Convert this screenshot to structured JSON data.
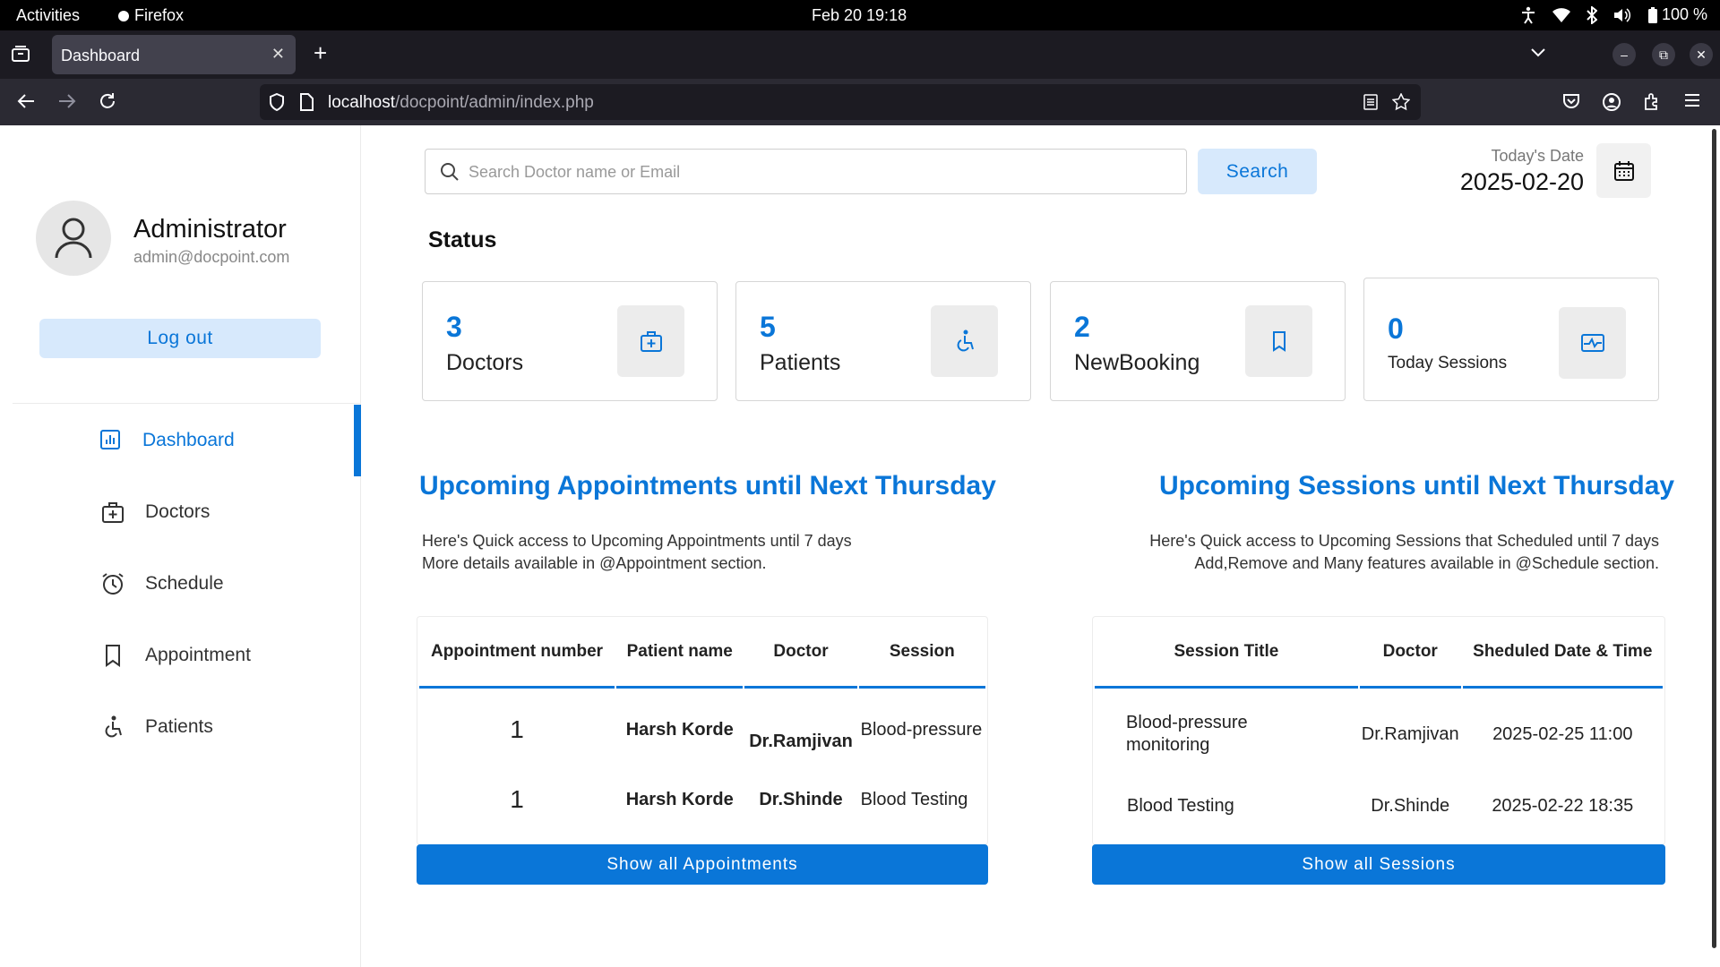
{
  "system_bar": {
    "activities": "Activities",
    "app_name": "Firefox",
    "clock": "Feb 20  19:18",
    "battery": "100 %"
  },
  "browser": {
    "tab_title": "Dashboard",
    "url_host": "localhost",
    "url_path": "/docpoint/admin/index.php"
  },
  "sidebar": {
    "user_name": "Administrator",
    "user_email": "admin@docpoint.com",
    "logout_label": "Log out",
    "items": [
      {
        "label": "Dashboard",
        "icon": "dashboard-icon",
        "active": true
      },
      {
        "label": "Doctors",
        "icon": "doctor-bag-icon",
        "active": false
      },
      {
        "label": "Schedule",
        "icon": "alarm-clock-icon",
        "active": false
      },
      {
        "label": "Appointment",
        "icon": "bookmark-icon",
        "active": false
      },
      {
        "label": "Patients",
        "icon": "wheelchair-icon",
        "active": false
      }
    ]
  },
  "search": {
    "placeholder": "Search Doctor name or Email",
    "button_label": "Search"
  },
  "date": {
    "label": "Today's Date",
    "value": "2025-02-20"
  },
  "status": {
    "title": "Status",
    "cards": [
      {
        "value": "3",
        "label": "Doctors",
        "icon": "doctor-bag-icon"
      },
      {
        "value": "5",
        "label": "Patients",
        "icon": "wheelchair-icon"
      },
      {
        "value": "2",
        "label": "NewBooking",
        "icon": "bookmark-icon"
      },
      {
        "value": "0",
        "label": "Today Sessions",
        "icon": "activity-icon"
      }
    ]
  },
  "appointments": {
    "title": "Upcoming Appointments until Next Thursday",
    "desc_line1": "Here's Quick access to Upcoming Appointments until 7 days",
    "desc_line2": "More details available in @Appointment section.",
    "columns": [
      "Appointment number",
      "Patient name",
      "Doctor",
      "Session"
    ],
    "rows": [
      {
        "number": "1",
        "patient": "Harsh Korde",
        "doctor": "Dr.Ramjivan",
        "session": "Blood-pressure"
      },
      {
        "number": "1",
        "patient": "Harsh Korde",
        "doctor": "Dr.Shinde",
        "session": "Blood Testing"
      }
    ],
    "button_label": "Show all Appointments"
  },
  "sessions": {
    "title": "Upcoming Sessions until Next Thursday",
    "desc_line1": "Here's Quick access to Upcoming Sessions that Scheduled until 7 days",
    "desc_line2": "Add,Remove and Many features available in @Schedule section.",
    "columns": [
      "Session Title",
      "Doctor",
      "Sheduled Date & Time"
    ],
    "rows": [
      {
        "title": "Blood-pressure monitoring",
        "doctor": "Dr.Ramjivan",
        "datetime": "2025-02-25 11:00"
      },
      {
        "title": "Blood Testing",
        "doctor": "Dr.Shinde",
        "datetime": "2025-02-22 18:35"
      }
    ],
    "button_label": "Show all Sessions"
  },
  "colors": {
    "accent": "#0a76d8",
    "accent_light": "#d7e9fc"
  }
}
